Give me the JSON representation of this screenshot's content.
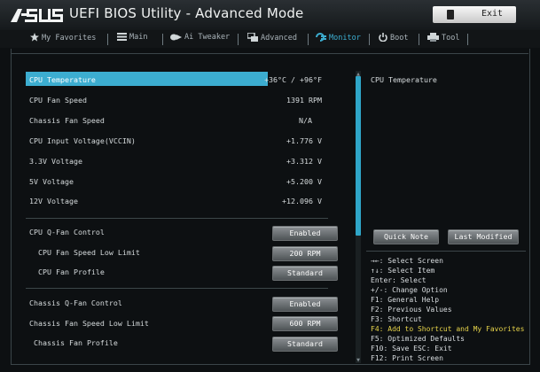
{
  "header": {
    "logo_text": "/ISUS",
    "title": "UEFI BIOS Utility - Advanced Mode",
    "exit_label": "Exit"
  },
  "menu": {
    "my_favorites": "My Favorites",
    "main": "Main",
    "ai_tweaker": "Ai Tweaker",
    "advanced": "Advanced",
    "monitor": "Monitor",
    "boot": "Boot",
    "tool": "Tool"
  },
  "monitor": {
    "cpu_temp_label": "CPU Temperature",
    "cpu_temp_value": "+36°C / +96°F",
    "cpu_fan_label": "CPU Fan Speed",
    "cpu_fan_value": "1391 RPM",
    "chassis_fan_label": "Chassis Fan Speed",
    "chassis_fan_value": "N/A",
    "vccin_label": "CPU Input Voltage(VCCIN)",
    "vccin_value": "+1.776 V",
    "v33_label": "3.3V Voltage",
    "v33_value": "+3.312 V",
    "v5_label": "5V Voltage",
    "v5_value": "+5.200 V",
    "v12_label": "12V Voltage",
    "v12_value": "+12.096 V"
  },
  "settings": {
    "cpu_qfan_label": "CPU Q-Fan Control",
    "cpu_qfan_value": "Enabled",
    "cpu_fan_low_label": "CPU Fan Speed Low Limit",
    "cpu_fan_low_value": "200 RPM",
    "cpu_fan_profile_label": "CPU Fan Profile",
    "cpu_fan_profile_value": "Standard",
    "chassis_qfan_label": "Chassis Q-Fan Control",
    "chassis_qfan_value": "Enabled",
    "chassis_fan_low_label": "Chassis Fan Speed Low Limit",
    "chassis_fan_low_value": "600 RPM",
    "chassis_fan_profile_label": "Chassis Fan Profile",
    "chassis_fan_profile_value": "Standard"
  },
  "help": {
    "title": "CPU Temperature",
    "quick_note": "Quick Note",
    "last_modified": "Last Modified",
    "keys": [
      "→←: Select Screen",
      "↑↓: Select Item",
      "Enter: Select",
      "+/-: Change Option",
      "F1: General Help",
      "F2: Previous Values",
      "F3: Shortcut",
      "F4: Add to Shortcut and My Favorites",
      "F5: Optimized Defaults",
      "F10: Save  ESC: Exit",
      "F12: Print Screen"
    ]
  },
  "colors": {
    "accent": "#3cadd0",
    "background": "#0d1012",
    "highlight_key": "#e6d34a"
  }
}
